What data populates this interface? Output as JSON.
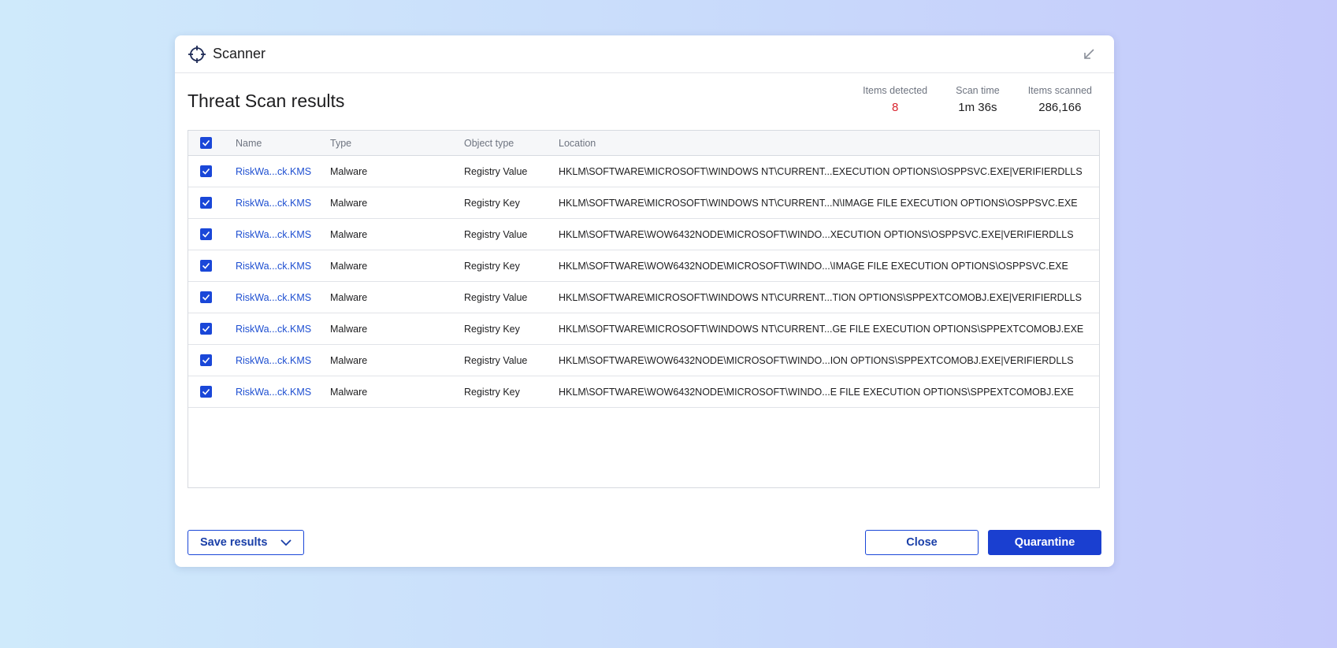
{
  "window": {
    "app_title": "Scanner",
    "page_title": "Threat Scan results"
  },
  "stats": {
    "detected_label": "Items detected",
    "detected_value": "8",
    "time_label": "Scan time",
    "time_value": "1m 36s",
    "scanned_label": "Items scanned",
    "scanned_value": "286,166"
  },
  "table": {
    "headers": {
      "name": "Name",
      "type": "Type",
      "object_type": "Object type",
      "location": "Location"
    },
    "rows": [
      {
        "name": "RiskWa...ck.KMS",
        "type": "Malware",
        "object_type": "Registry Value",
        "location": "HKLM\\SOFTWARE\\MICROSOFT\\WINDOWS NT\\CURRENT...EXECUTION OPTIONS\\OSPPSVC.EXE|VERIFIERDLLS"
      },
      {
        "name": "RiskWa...ck.KMS",
        "type": "Malware",
        "object_type": "Registry Key",
        "location": "HKLM\\SOFTWARE\\MICROSOFT\\WINDOWS NT\\CURRENT...N\\IMAGE FILE EXECUTION OPTIONS\\OSPPSVC.EXE"
      },
      {
        "name": "RiskWa...ck.KMS",
        "type": "Malware",
        "object_type": "Registry Value",
        "location": "HKLM\\SOFTWARE\\WOW6432NODE\\MICROSOFT\\WINDO...XECUTION OPTIONS\\OSPPSVC.EXE|VERIFIERDLLS"
      },
      {
        "name": "RiskWa...ck.KMS",
        "type": "Malware",
        "object_type": "Registry Key",
        "location": "HKLM\\SOFTWARE\\WOW6432NODE\\MICROSOFT\\WINDO...\\IMAGE FILE EXECUTION OPTIONS\\OSPPSVC.EXE"
      },
      {
        "name": "RiskWa...ck.KMS",
        "type": "Malware",
        "object_type": "Registry Value",
        "location": "HKLM\\SOFTWARE\\MICROSOFT\\WINDOWS NT\\CURRENT...TION OPTIONS\\SPPEXTCOMOBJ.EXE|VERIFIERDLLS"
      },
      {
        "name": "RiskWa...ck.KMS",
        "type": "Malware",
        "object_type": "Registry Key",
        "location": "HKLM\\SOFTWARE\\MICROSOFT\\WINDOWS NT\\CURRENT...GE FILE EXECUTION OPTIONS\\SPPEXTCOMOBJ.EXE"
      },
      {
        "name": "RiskWa...ck.KMS",
        "type": "Malware",
        "object_type": "Registry Value",
        "location": "HKLM\\SOFTWARE\\WOW6432NODE\\MICROSOFT\\WINDO...ION OPTIONS\\SPPEXTCOMOBJ.EXE|VERIFIERDLLS"
      },
      {
        "name": "RiskWa...ck.KMS",
        "type": "Malware",
        "object_type": "Registry Key",
        "location": "HKLM\\SOFTWARE\\WOW6432NODE\\MICROSOFT\\WINDO...E FILE EXECUTION OPTIONS\\SPPEXTCOMOBJ.EXE"
      }
    ]
  },
  "footer": {
    "save_label": "Save results",
    "close_label": "Close",
    "quarantine_label": "Quarantine"
  },
  "icons": {
    "app": "crosshair-icon",
    "minimize": "arrow-down-left-icon",
    "check": "check-icon",
    "dropdown": "chevron-down-icon"
  },
  "colors": {
    "accent": "#1a47d8",
    "link": "#1e4fd1",
    "danger": "#d9232e"
  }
}
